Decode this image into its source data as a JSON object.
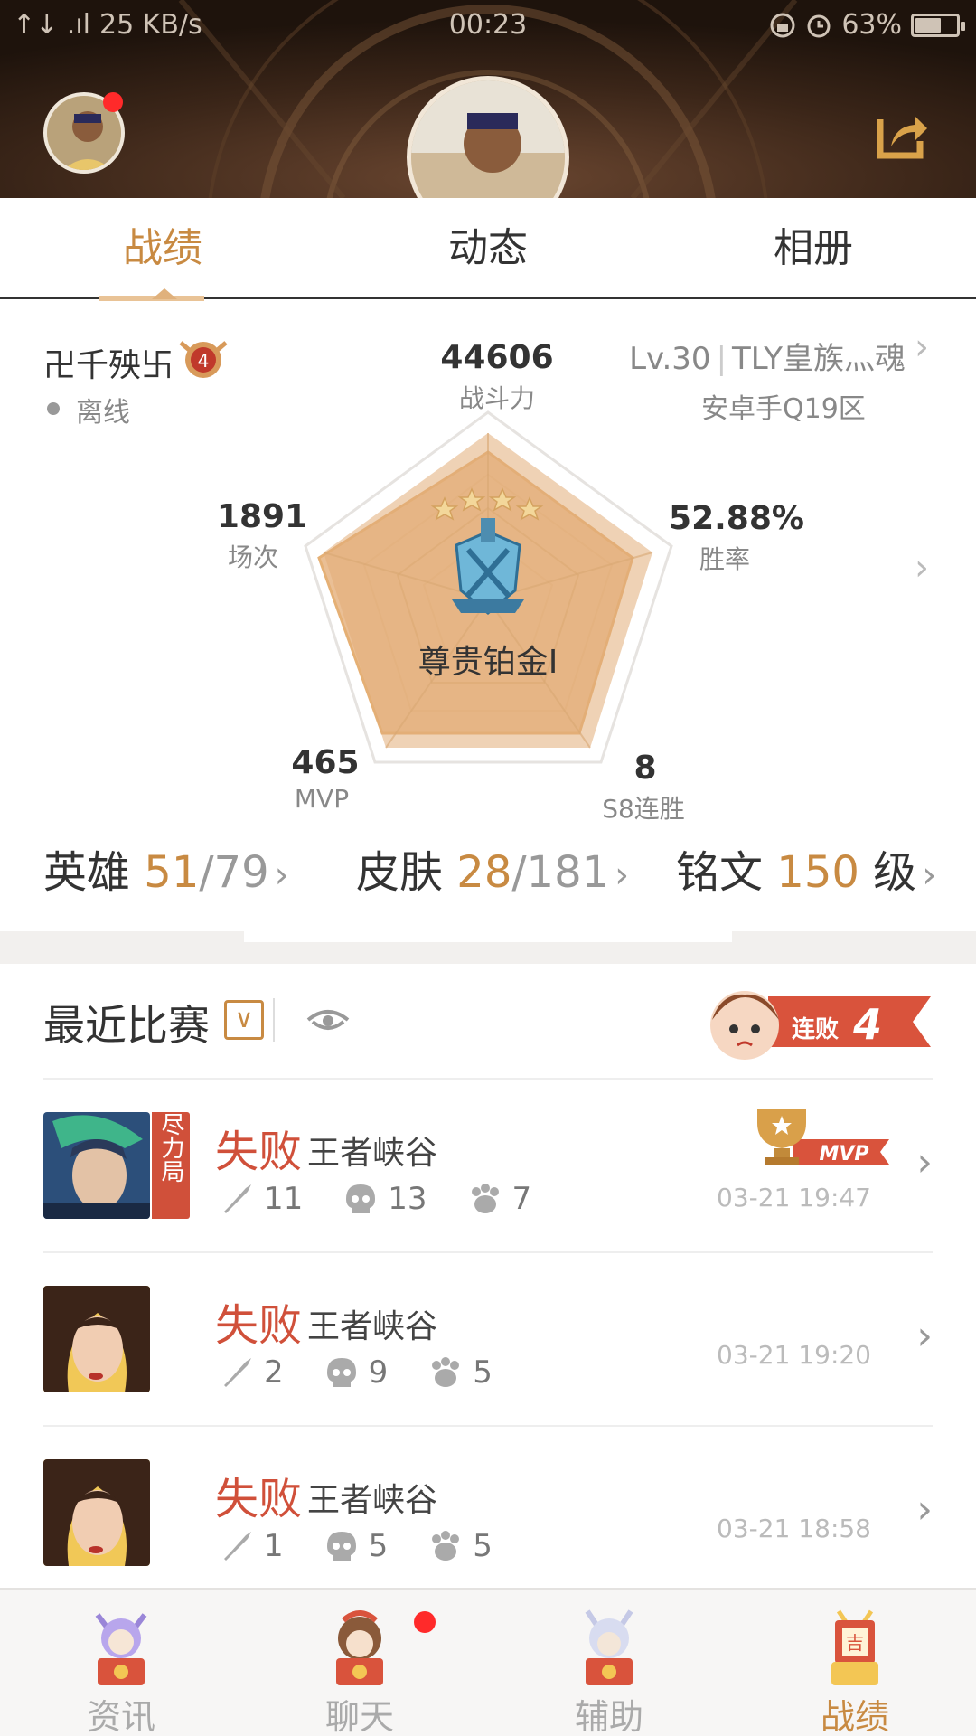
{
  "statusbar": {
    "signal": "↑↓ .ıl",
    "speed": "25 KB/s",
    "time": "00:23",
    "battery": "63%",
    "battery_level": 0.63
  },
  "tabs": [
    "战绩",
    "动态",
    "相册"
  ],
  "profile": {
    "name": "卍千殃卐",
    "rank_badge_num": "4",
    "status": "离线",
    "level": "Lv.30",
    "guild": "TLY皇族灬魂",
    "server": "安卓手Q19区",
    "rank_name": "尊贵铂金I"
  },
  "stats": {
    "power": {
      "value": "44606",
      "label": "战斗力"
    },
    "winrate": {
      "value": "52.88%",
      "label": "胜率"
    },
    "streak": {
      "value": "8",
      "label": "S8连胜"
    },
    "mvp": {
      "value": "465",
      "label": "MVP"
    },
    "matches": {
      "value": "1891",
      "label": "场次"
    }
  },
  "counts": {
    "heroes": {
      "label": "英雄",
      "owned": "51",
      "total": "79"
    },
    "skins": {
      "label": "皮肤",
      "owned": "28",
      "total": "181"
    },
    "runes": {
      "label": "铭文",
      "value": "150",
      "unit": "级"
    }
  },
  "recent": {
    "title": "最近比赛",
    "streak_label": "连败",
    "streak_count": "4",
    "matches": [
      {
        "result": "失败",
        "mode": "王者峡谷",
        "kills": "11",
        "deaths": "13",
        "assists": "7",
        "time": "03-21 19:47",
        "tag": "尽力局",
        "mvp": "MVP"
      },
      {
        "result": "失败",
        "mode": "王者峡谷",
        "kills": "2",
        "deaths": "9",
        "assists": "5",
        "time": "03-21 19:20"
      },
      {
        "result": "失败",
        "mode": "王者峡谷",
        "kills": "1",
        "deaths": "5",
        "assists": "5",
        "time": "03-21 18:58"
      }
    ]
  },
  "nav": [
    "资讯",
    "聊天",
    "辅助",
    "战绩"
  ],
  "colors": {
    "accent": "#c88a42",
    "loss": "#d0503a",
    "header_bg": "#3a2518"
  }
}
